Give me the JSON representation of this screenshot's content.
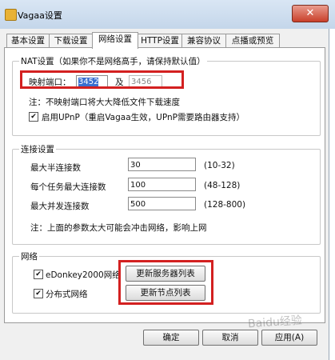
{
  "window": {
    "title": "Vagaa设置",
    "close_glyph": "✕"
  },
  "tabs": [
    {
      "label": "基本设置"
    },
    {
      "label": "下载设置"
    },
    {
      "label": "网络设置",
      "active": true
    },
    {
      "label": "HTTP设置"
    },
    {
      "label": "兼容协议"
    },
    {
      "label": "点播或预览"
    }
  ],
  "nat": {
    "legend": "NAT设置（如果你不是网络高手，请保持默认值）",
    "port_label": "映射端口：",
    "port_value": "3452",
    "and_label": "及",
    "port_value2": "3456",
    "note": "注：不映射端口将大大降低文件下载速度",
    "upnp_checked": "✔",
    "upnp_label": "启用UPnP（重启Vagaa生效，UPnP需要路由器支持）"
  },
  "connection": {
    "legend": "连接设置",
    "rows": [
      {
        "label": "最大半连接数",
        "value": "30",
        "range": "(10-32)"
      },
      {
        "label": "每个任务最大连接数",
        "value": "100",
        "range": "(48-128)"
      },
      {
        "label": "最大并发连接数",
        "value": "500",
        "range": "(128-800)"
      }
    ],
    "note": "注：上面的参数太大可能会冲击网络，影响上网"
  },
  "network": {
    "legend": "网络",
    "edonkey_label": "eDonkey2000网络",
    "edonkey_checked": "✔",
    "dist_label": "分布式网络",
    "dist_checked": "✔",
    "update_servers": "更新服务器列表",
    "update_nodes": "更新节点列表"
  },
  "footer": {
    "ok": "确定",
    "cancel": "取消",
    "apply": "应用(A)"
  },
  "watermark": "Baidu经验"
}
